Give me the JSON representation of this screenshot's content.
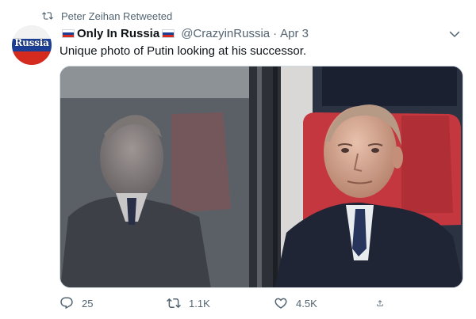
{
  "retweet": {
    "text": "Peter Zeihan Retweeted",
    "icon": "retweet-icon"
  },
  "author": {
    "display_name": "Only In Russia",
    "handle": "@CrazyinRussia",
    "separator": "·",
    "time": "Apr 3",
    "avatar_text": "Russia"
  },
  "tweet": {
    "text": "Unique photo of Putin looking at his successor."
  },
  "media": {
    "description_icon": "photo"
  },
  "actions": {
    "reply_count": "25",
    "retweet_count": "1.1K",
    "like_count": "4.5K"
  },
  "colors": {
    "text_primary": "#0f1419",
    "text_secondary": "#536471",
    "flag_blue": "#1c3f95",
    "flag_red": "#d52b1e",
    "seat_red": "#c5373f"
  }
}
